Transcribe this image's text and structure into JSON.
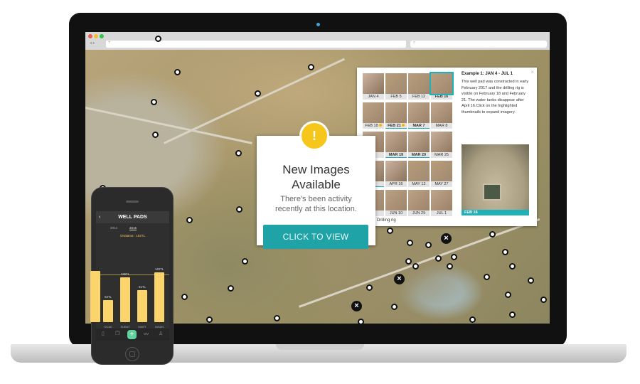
{
  "browser": {
    "url_placeholder": "+",
    "search_icon": "search-icon",
    "traffic_lights": [
      "#ee5b53",
      "#f4bd2f",
      "#2ec74a"
    ]
  },
  "panel": {
    "title": "Example 1: JAN 4 - JUL 1",
    "description": "This well pad was constructed in early February 2017 and the drilling rig is visible on February 18 and February 21. The water tanks disappear after April 16.Click on the highlighted thumbnails to expand imagery.",
    "thumbnails": [
      {
        "label": "JAN 4"
      },
      {
        "label": "FEB 5"
      },
      {
        "label": "FEB 12"
      },
      {
        "label": "FEB 16",
        "bold": true,
        "selected": true
      },
      {
        "label": "FEB 18",
        "dot": true
      },
      {
        "label": "FEB 21",
        "dot": true,
        "bold": true,
        "highlighted": true
      },
      {
        "label": "MAR 7",
        "bold": true,
        "highlighted": true
      },
      {
        "label": "MAR 8"
      },
      {
        "label": ""
      },
      {
        "label": "MAR 19",
        "bold": true,
        "highlighted": true
      },
      {
        "label": "MAR 20",
        "bold": true,
        "highlighted": true
      },
      {
        "label": "MAR 25"
      },
      {
        "label": "",
        "highlighted": true
      },
      {
        "label": "APR 16"
      },
      {
        "label": "MAY 12"
      },
      {
        "label": "MAY 27"
      },
      {
        "label": ""
      },
      {
        "label": "JUN 10"
      },
      {
        "label": "JUN 29"
      },
      {
        "label": "JUL 1"
      }
    ],
    "preview_caption": "FEB 16",
    "legend": "Drilling rig",
    "close": "×",
    "accent": "#1fb0b8"
  },
  "popup": {
    "icon": "warning-icon",
    "title_line1": "New Images",
    "title_line2": "Available",
    "subtitle_line1": "There's been activity",
    "subtitle_line2": "recently at this location.",
    "button": "CLICK TO VIEW",
    "button_color": "#1fa3a7",
    "icon_color": "#f6c61a"
  },
  "phone": {
    "title": "WELL PADS",
    "back": "‹",
    "years": [
      "2014",
      "2015"
    ],
    "active_year": "2015",
    "average": "Ortalama : 102TL",
    "chart_data": {
      "type": "bar",
      "categories": [
        "OCAK",
        "SUBAT",
        "MART",
        "NISAN"
      ],
      "values": [
        63,
        126,
        91,
        140
      ],
      "labels": [
        "63TL",
        "126TL",
        "91TL",
        "140TL"
      ],
      "average": 102,
      "color": "#fbd56b"
    },
    "nav_icons": [
      "document-icon",
      "copy-icon",
      "plus-icon",
      "chart-icon",
      "user-icon"
    ]
  }
}
